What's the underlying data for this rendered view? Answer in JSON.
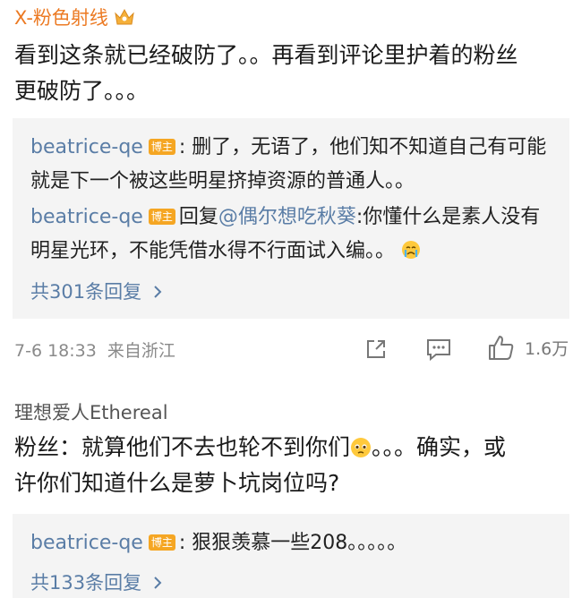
{
  "comment1": {
    "user": "X-粉色射线",
    "text": "看到这条就已经破防了。。再看到评论里护着的粉丝更破防了。。。",
    "text_line1": "看到这条就已经破防了。。再看到评论里护着的粉丝",
    "text_line2": "更破防了。。。",
    "replies": [
      {
        "name": "beatrice-qe",
        "badge": "博主",
        "sep": ":",
        "line1": "删了，无语了，他们知不知道自己有可能",
        "line2": "就是下一个被这些明星挤掉资源的普通人。。"
      },
      {
        "name": "beatrice-qe",
        "badge": "博主",
        "reply_word": "回复",
        "mention": "@偶尔想吃秋葵",
        "line1": ":你懂什么是素人没有",
        "line2": "明星光环，不能凭借水得不行面试入编。。"
      }
    ],
    "more_replies": "共301条回复",
    "time": "7-6 18:33",
    "source": "来自浙江",
    "likes": "1.6万"
  },
  "comment2": {
    "user": "理想爱人Ethereal",
    "text_line1a": "粉丝：就算他们不去也轮不到你们",
    "text_line1b": "。。。确实，或",
    "text_line2": "许你们知道什么是萝卜坑岗位吗?",
    "replies": [
      {
        "name": "beatrice-qe",
        "badge": "博主",
        "sep": ":",
        "line1": "狠狠羡慕一些208。。。。。"
      }
    ],
    "more_replies": "共133条回复"
  },
  "colors": {
    "username_orange": "#ec7a23",
    "link_blue": "#5a7da6",
    "badge_orange": "#f5a623",
    "reply_bg": "#f4f4f4",
    "meta_gray": "#8a8a8a"
  },
  "icons": [
    "crown-icon",
    "share-icon",
    "comment-icon",
    "like-icon",
    "chevron-right-icon",
    "crying-emoji-icon",
    "pleading-emoji-icon"
  ]
}
